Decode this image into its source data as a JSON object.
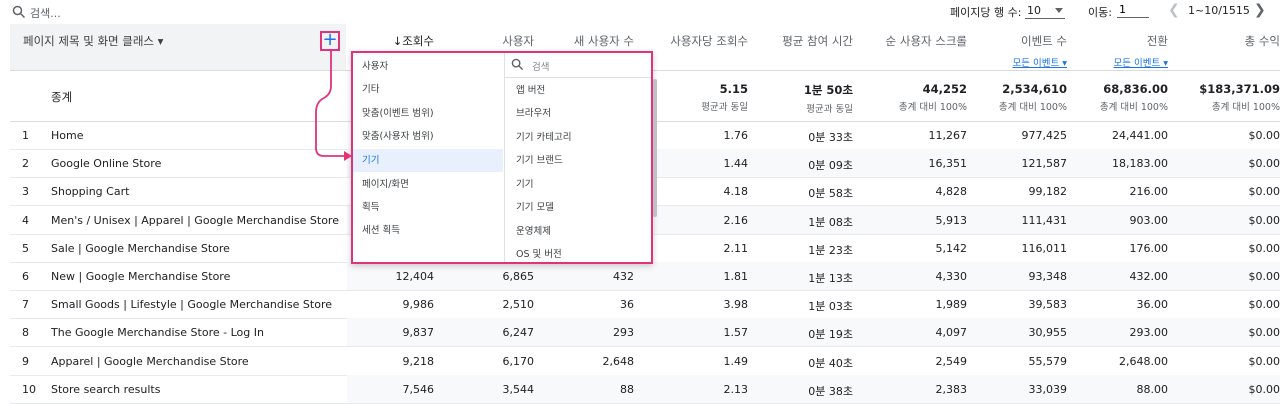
{
  "topbar": {
    "search_placeholder": "검색...",
    "rows_per_page_label": "페이지당 행 수:",
    "rows_per_page_value": "10",
    "goto_label": "이동:",
    "goto_value": "1",
    "page_range": "1~10/1515"
  },
  "header": {
    "dimension_label": "페이지 제목 및 화면 클래스",
    "add_label": "+",
    "columns": [
      {
        "label": "↓조회수",
        "sub": ""
      },
      {
        "label": "사용자",
        "sub": ""
      },
      {
        "label": "새 사용자 수",
        "sub": ""
      },
      {
        "label": "사용자당 조회수",
        "sub": ""
      },
      {
        "label": "평균 참여 시간",
        "sub": ""
      },
      {
        "label": "순 사용자 스크롤",
        "sub": ""
      },
      {
        "label": "이벤트 수",
        "sub": "모든 이벤트 ▾"
      },
      {
        "label": "전환",
        "sub": "모든 이벤트 ▾"
      },
      {
        "label": "총 수익",
        "sub": ""
      }
    ]
  },
  "totals": {
    "label": "종계",
    "cells": [
      {
        "value": "5.15",
        "caption": "평균과 동일"
      },
      {
        "value": "1분 50초",
        "caption": "평균과 동일"
      },
      {
        "value": "44,252",
        "caption": "총계 대비 100%"
      },
      {
        "value": "2,534,610",
        "caption": "총계 대비 100%"
      },
      {
        "value": "68,836.00",
        "caption": "총계 대비 100%"
      },
      {
        "value": "$183,371.09",
        "caption": "총계 대비 100%"
      }
    ]
  },
  "rows": [
    {
      "idx": "1",
      "name": "Home",
      "views": "",
      "users": "",
      "new_users": "",
      "vpu": "1.76",
      "eng": "0분 33초",
      "scroll": "11,267",
      "events": "977,425",
      "conv": "24,441.00",
      "rev": "$0.00"
    },
    {
      "idx": "2",
      "name": "Google Online Store",
      "views": "",
      "users": "",
      "new_users": "",
      "vpu": "1.44",
      "eng": "0분 09초",
      "scroll": "16,351",
      "events": "121,587",
      "conv": "18,183.00",
      "rev": "$0.00"
    },
    {
      "idx": "3",
      "name": "Shopping Cart",
      "views": "",
      "users": "",
      "new_users": "",
      "vpu": "4.18",
      "eng": "0분 58초",
      "scroll": "4,828",
      "events": "99,182",
      "conv": "216.00",
      "rev": "$0.00"
    },
    {
      "idx": "4",
      "name": "Men's / Unisex | Apparel | Google Merchandise Store",
      "views": "",
      "users": "",
      "new_users": "",
      "vpu": "2.16",
      "eng": "1분 08초",
      "scroll": "5,913",
      "events": "111,431",
      "conv": "903.00",
      "rev": "$0.00"
    },
    {
      "idx": "5",
      "name": "Sale | Google Merchandise Store",
      "views": "",
      "users": "",
      "new_users": "",
      "vpu": "2.11",
      "eng": "1분 23초",
      "scroll": "5,142",
      "events": "116,011",
      "conv": "176.00",
      "rev": "$0.00"
    },
    {
      "idx": "6",
      "name": "New | Google Merchandise Store",
      "views": "12,404",
      "users": "6,865",
      "new_users": "432",
      "vpu": "1.81",
      "eng": "1분 13초",
      "scroll": "4,330",
      "events": "93,348",
      "conv": "432.00",
      "rev": "$0.00"
    },
    {
      "idx": "7",
      "name": "Small Goods | Lifestyle | Google Merchandise Store",
      "views": "9,986",
      "users": "2,510",
      "new_users": "36",
      "vpu": "3.98",
      "eng": "1분 03초",
      "scroll": "1,989",
      "events": "39,583",
      "conv": "36.00",
      "rev": "$0.00"
    },
    {
      "idx": "8",
      "name": "The Google Merchandise Store - Log In",
      "views": "9,837",
      "users": "6,247",
      "new_users": "293",
      "vpu": "1.57",
      "eng": "0분 19초",
      "scroll": "4,097",
      "events": "30,955",
      "conv": "293.00",
      "rev": "$0.00"
    },
    {
      "idx": "9",
      "name": "Apparel | Google Merchandise Store",
      "views": "9,218",
      "users": "6,170",
      "new_users": "2,648",
      "vpu": "1.49",
      "eng": "0분 40초",
      "scroll": "2,549",
      "events": "55,579",
      "conv": "2,648.00",
      "rev": "$0.00"
    },
    {
      "idx": "10",
      "name": "Store search results",
      "views": "7,546",
      "users": "3,544",
      "new_users": "88",
      "vpu": "2.13",
      "eng": "0분 38초",
      "scroll": "2,383",
      "events": "33,039",
      "conv": "88.00",
      "rev": "$0.00"
    }
  ],
  "dropdown": {
    "categories": [
      "사용자",
      "기타",
      "맞춤(이벤트 범위)",
      "맞춤(사용자 범위)",
      "기기",
      "페이지/화면",
      "획득",
      "세션 획득"
    ],
    "search_placeholder": "검색",
    "options": [
      "앱 버전",
      "브라우저",
      "기기 카테고리",
      "기기 브랜드",
      "기기",
      "기기 모델",
      "운영체제",
      "OS 및 버전"
    ]
  },
  "colors": {
    "accent": "#1a73e8",
    "highlight": "#e0337c"
  }
}
